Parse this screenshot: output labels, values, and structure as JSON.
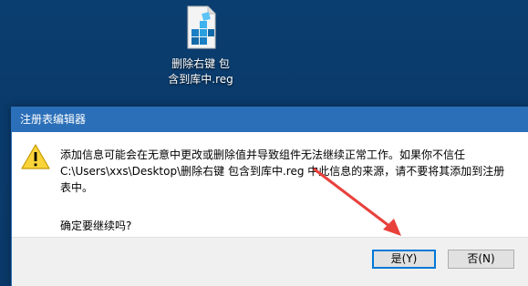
{
  "desktop": {
    "file_icon": "registry-file-icon",
    "file_label_line1": "删除右键 包",
    "file_label_line2": "含到库中.reg"
  },
  "dialog": {
    "title": "注册表编辑器",
    "warning_icon": "warning-triangle-icon",
    "message_line1": "添加信息可能会在无意中更改或删除值并导致组件无法继续正常工作。如果你不信任",
    "message_line2": "C:\\Users\\xxs\\Desktop\\删除右键 包含到库中.reg 中此信息的来源，请不要将其添加到注册",
    "message_line3": "表中。",
    "question": "确定要继续吗?",
    "yes_button": "是(Y)",
    "no_button": "否(N)"
  },
  "annotation": {
    "arrow_color": "#e8413c"
  }
}
